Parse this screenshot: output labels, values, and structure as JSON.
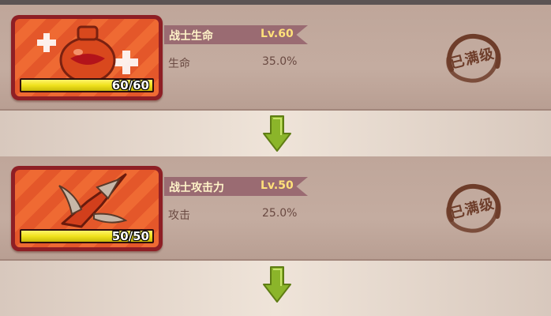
{
  "skills": [
    {
      "name": "战士生命",
      "level": "Lv.60",
      "stat_label": "生命",
      "stat_value": "35.0%",
      "progress_text": "60/60",
      "progress_fraction": 1.0,
      "status": "已满级",
      "icon": "potion-bottle-icon"
    },
    {
      "name": "战士攻击力",
      "level": "Lv.50",
      "stat_label": "攻击",
      "stat_value": "25.0%",
      "progress_text": "50/50",
      "progress_fraction": 1.0,
      "status": "已满级",
      "icon": "shuriken-blade-icon"
    }
  ],
  "colors": {
    "card_border": "#8e1f25",
    "card_bg": "#e4572a",
    "bar_fill": "#f0e21c",
    "ribbon": "#9a6b72",
    "level_text": "#ffe07a",
    "stamp": "#6e3d2a",
    "arrow": "#8bb52a"
  }
}
